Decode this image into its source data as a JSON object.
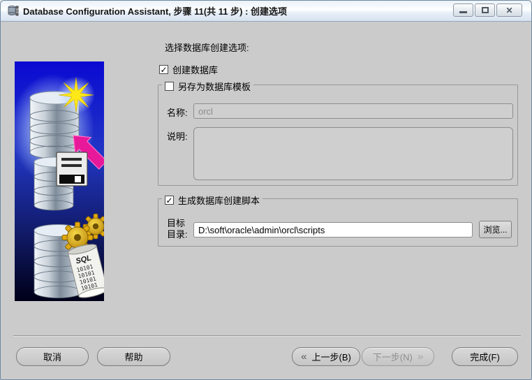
{
  "window": {
    "title": "Database Configuration Assistant, 步骤 11(共 11 步) : 创建选项"
  },
  "icons": {
    "check": "✓",
    "close": "✕",
    "back_chevron": "«",
    "next_chevron": "»"
  },
  "colors": {
    "dialog_bg": "#cbcbcb",
    "art_blue_top": "#0a0ad0",
    "art_blue_bottom": "#000020",
    "arrow_magenta": "#e8189a",
    "star_yellow": "#ffe818",
    "gear_gold": "#e0a810"
  },
  "main": {
    "prompt": "选择数据库创建选项:",
    "create_db_checkbox": {
      "label": "创建数据库",
      "checked": true
    },
    "template_group": {
      "title": "另存为数据库模板",
      "checked": false,
      "name_label": "名称:",
      "name_value": "orcl",
      "desc_label": "说明:",
      "desc_value": ""
    },
    "scripts_group": {
      "title": "生成数据库创建脚本",
      "checked": true,
      "dir_label_line1": "目标",
      "dir_label_line2": "目录:",
      "dir_value": "D:\\soft\\oracle\\admin\\orcl\\scripts",
      "browse_label": "浏览..."
    }
  },
  "footer": {
    "cancel": "取消",
    "help": "帮助",
    "back": "上一步(B)",
    "next": "下一步(N)",
    "finish": "完成(F)"
  },
  "sidebar_art": {
    "sql_text": "SQL",
    "binary_lines": [
      "10101",
      "10101",
      "10101",
      "10101"
    ]
  }
}
